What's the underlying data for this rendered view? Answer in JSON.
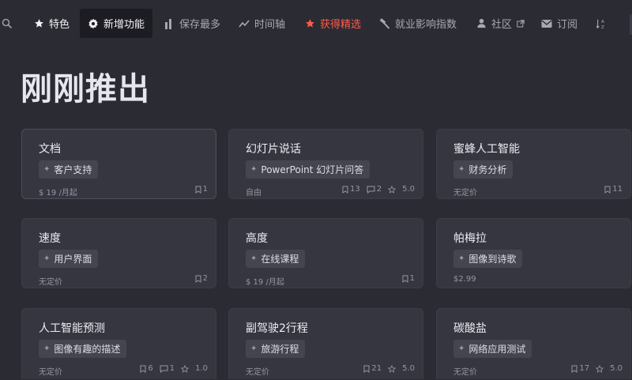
{
  "nav": {
    "search_icon": "search-icon",
    "items": [
      {
        "label": "特色",
        "icon": "star-icon"
      },
      {
        "label": "新增功能",
        "icon": "gear-icon"
      },
      {
        "label": "保存最多",
        "icon": "bars-icon"
      },
      {
        "label": "时间轴",
        "icon": "trend-icon"
      },
      {
        "label": "获得精选",
        "icon": "star-icon"
      },
      {
        "label": "就业影响指数",
        "icon": "hammer-icon"
      },
      {
        "label": "社区",
        "icon": "user-icon",
        "external": true
      },
      {
        "label": "订阅",
        "icon": "envelope-icon"
      }
    ],
    "sort_icon": "sort-az-icon"
  },
  "page": {
    "title": "刚刚推出"
  },
  "cards": [
    {
      "title": "文档",
      "tag": "客户支持",
      "price": "$ 19 /月起",
      "saves": "1"
    },
    {
      "title": "幻灯片说话",
      "tag": "PowerPoint 幻灯片问答",
      "price": "自由",
      "saves": "13",
      "comments": "2",
      "rating": "5.0"
    },
    {
      "title": "蜜蜂人工智能",
      "tag": "财务分析",
      "price": "无定价",
      "saves": "11"
    },
    {
      "title": "速度",
      "tag": "用户界面",
      "price": "无定价",
      "saves": "2"
    },
    {
      "title": "高度",
      "tag": "在线课程",
      "price": "$ 19 /月起",
      "saves": "1"
    },
    {
      "title": "帕梅拉",
      "tag": "图像到诗歌",
      "price": "$2.99",
      "saves": ""
    },
    {
      "title": "人工智能预测",
      "tag": "图像有趣的描述",
      "price": "无定价",
      "saves": "6",
      "comments": "1",
      "rating": "1.0"
    },
    {
      "title": "副驾驶2行程",
      "tag": "旅游行程",
      "price": "无定价",
      "saves": "21",
      "rating": "5.0"
    },
    {
      "title": "碳酸盐",
      "tag": "网络应用测试",
      "price": "无定价",
      "saves": "17",
      "rating": "5.0"
    }
  ],
  "colors": {
    "background": "#2b2b33",
    "card": "#363640",
    "tag": "#45454f",
    "accent_hot": "#ff5b4a"
  }
}
